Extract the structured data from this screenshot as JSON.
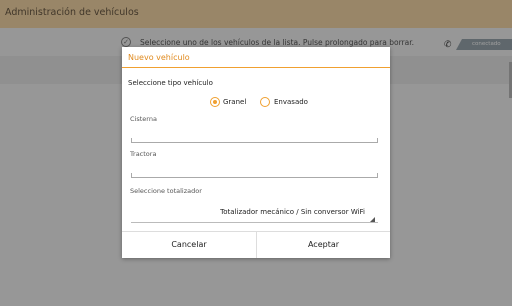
{
  "app": {
    "title": "Administración de vehículos",
    "info_text": "Seleccione uno de los vehículos de la lista. Pulse prolongado para borrar.",
    "info_icon": "check-circle-icon",
    "phone_icon": "phone-icon",
    "connection_status": "conectado"
  },
  "dialog": {
    "title": "Nuevo vehículo",
    "vehicle_type_label": "Seleccione tipo vehículo",
    "vehicle_types": [
      {
        "label": "Granel",
        "selected": true
      },
      {
        "label": "Envasado",
        "selected": false
      }
    ],
    "cisterna": {
      "label": "Cisterna",
      "value": ""
    },
    "tractora": {
      "label": "Tractora",
      "value": ""
    },
    "totalizador": {
      "label": "Seleccione totalizador",
      "value": "Totalizador mecánico / Sin conversor WiFi"
    },
    "cancel_label": "Cancelar",
    "accept_label": "Aceptar"
  },
  "colors": {
    "accent": "#f0a030",
    "appbar": "#f7d8a8",
    "badge": "#9aa7ae"
  }
}
